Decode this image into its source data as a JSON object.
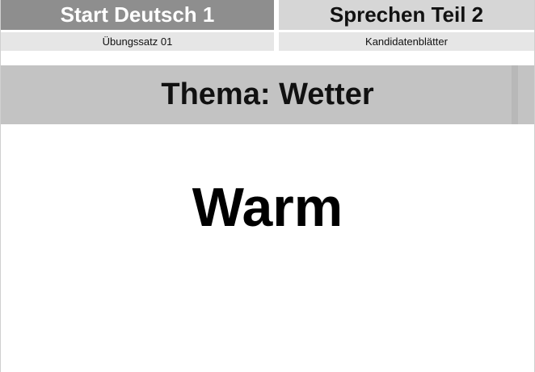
{
  "header": {
    "left_title": "Start Deutsch 1",
    "right_title": "Sprechen Teil 2"
  },
  "subheader": {
    "left_label": "Übungssatz 01",
    "right_label": "Kandidatenblätter"
  },
  "thema": {
    "title": "Thema: Wetter"
  },
  "card": {
    "word": "Warm"
  },
  "colors": {
    "dark_header": "#8e8e8e",
    "light_header": "#d6d6d6",
    "sub_header": "#e6e6e6",
    "thema_band": "#c3c3c3"
  }
}
